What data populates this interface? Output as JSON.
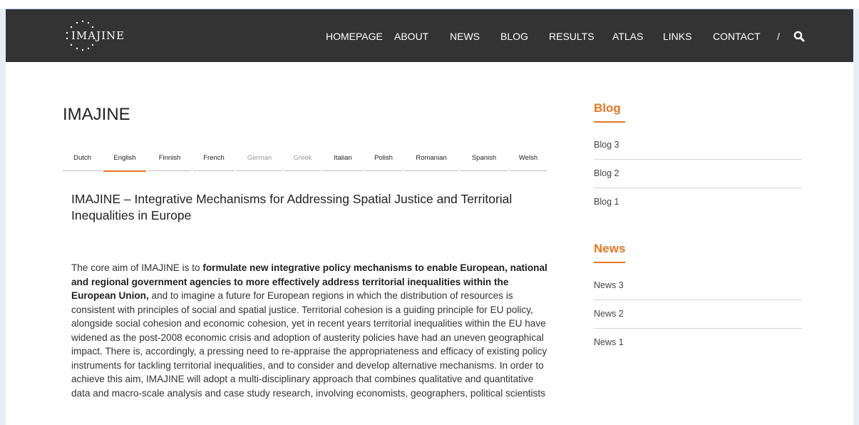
{
  "site": {
    "logo_text": "IMAJINE"
  },
  "nav": {
    "items": [
      {
        "label": "HOMEPAGE"
      },
      {
        "label": "ABOUT"
      },
      {
        "label": "NEWS"
      },
      {
        "label": "BLOG"
      },
      {
        "label": "RESULTS"
      },
      {
        "label": "ATLAS"
      },
      {
        "label": "LINKS"
      },
      {
        "label": "CONTACT"
      }
    ],
    "separator": "/",
    "search_icon": "search-icon"
  },
  "main": {
    "title": "IMAJINE",
    "tabs": [
      {
        "label": "Dutch",
        "state": "normal"
      },
      {
        "label": "English",
        "state": "active"
      },
      {
        "label": "Finnish",
        "state": "normal"
      },
      {
        "label": "French",
        "state": "normal"
      },
      {
        "label": "German",
        "state": "muted"
      },
      {
        "label": "Greek",
        "state": "muted"
      },
      {
        "label": "Italian",
        "state": "normal"
      },
      {
        "label": "Polish",
        "state": "normal"
      },
      {
        "label": "Romanian",
        "state": "normal"
      },
      {
        "label": "Spanish",
        "state": "normal"
      },
      {
        "label": "Welsh",
        "state": "normal"
      }
    ],
    "heading": "IMAJINE – Integrative Mechanisms for Addressing Spatial Justice and Territorial Inequalities in Europe",
    "body": {
      "intro": "The core aim of IMAJINE is to ",
      "bold": "formulate new integrative policy mechanisms to enable European, national and regional government agencies to more effectively address territorial inequalities within the European Union,",
      "rest": " and to imagine a future for European regions in which the distribution of resources is consistent with principles of social and spatial justice. Territorial cohesion is a guiding principle for EU policy, alongside social cohesion and economic cohesion, yet in recent years territorial inequalities within the EU have widened as the post-2008 economic crisis and adoption of austerity policies have had an uneven geographical impact. There is, accordingly, a pressing need to re-appraise the appropriateness and efficacy of existing policy instruments for tackling territorial inequalities, and to consider and develop alternative mechanisms. In order to achieve this aim, IMAJINE will adopt a multi-disciplinary approach that combines qualitative and quantitative data and macro-scale analysis and case study research, involving economists, geographers, political scientists"
    }
  },
  "sidebar": {
    "blog": {
      "heading": "Blog",
      "items": [
        {
          "label": "Blog 3"
        },
        {
          "label": "Blog 2"
        },
        {
          "label": "Blog 1"
        }
      ]
    },
    "news": {
      "heading": "News",
      "items": [
        {
          "label": "News 3"
        },
        {
          "label": "News 2"
        },
        {
          "label": "News 1"
        }
      ]
    }
  },
  "colors": {
    "accent": "#e87722",
    "header_bg": "#333333"
  }
}
